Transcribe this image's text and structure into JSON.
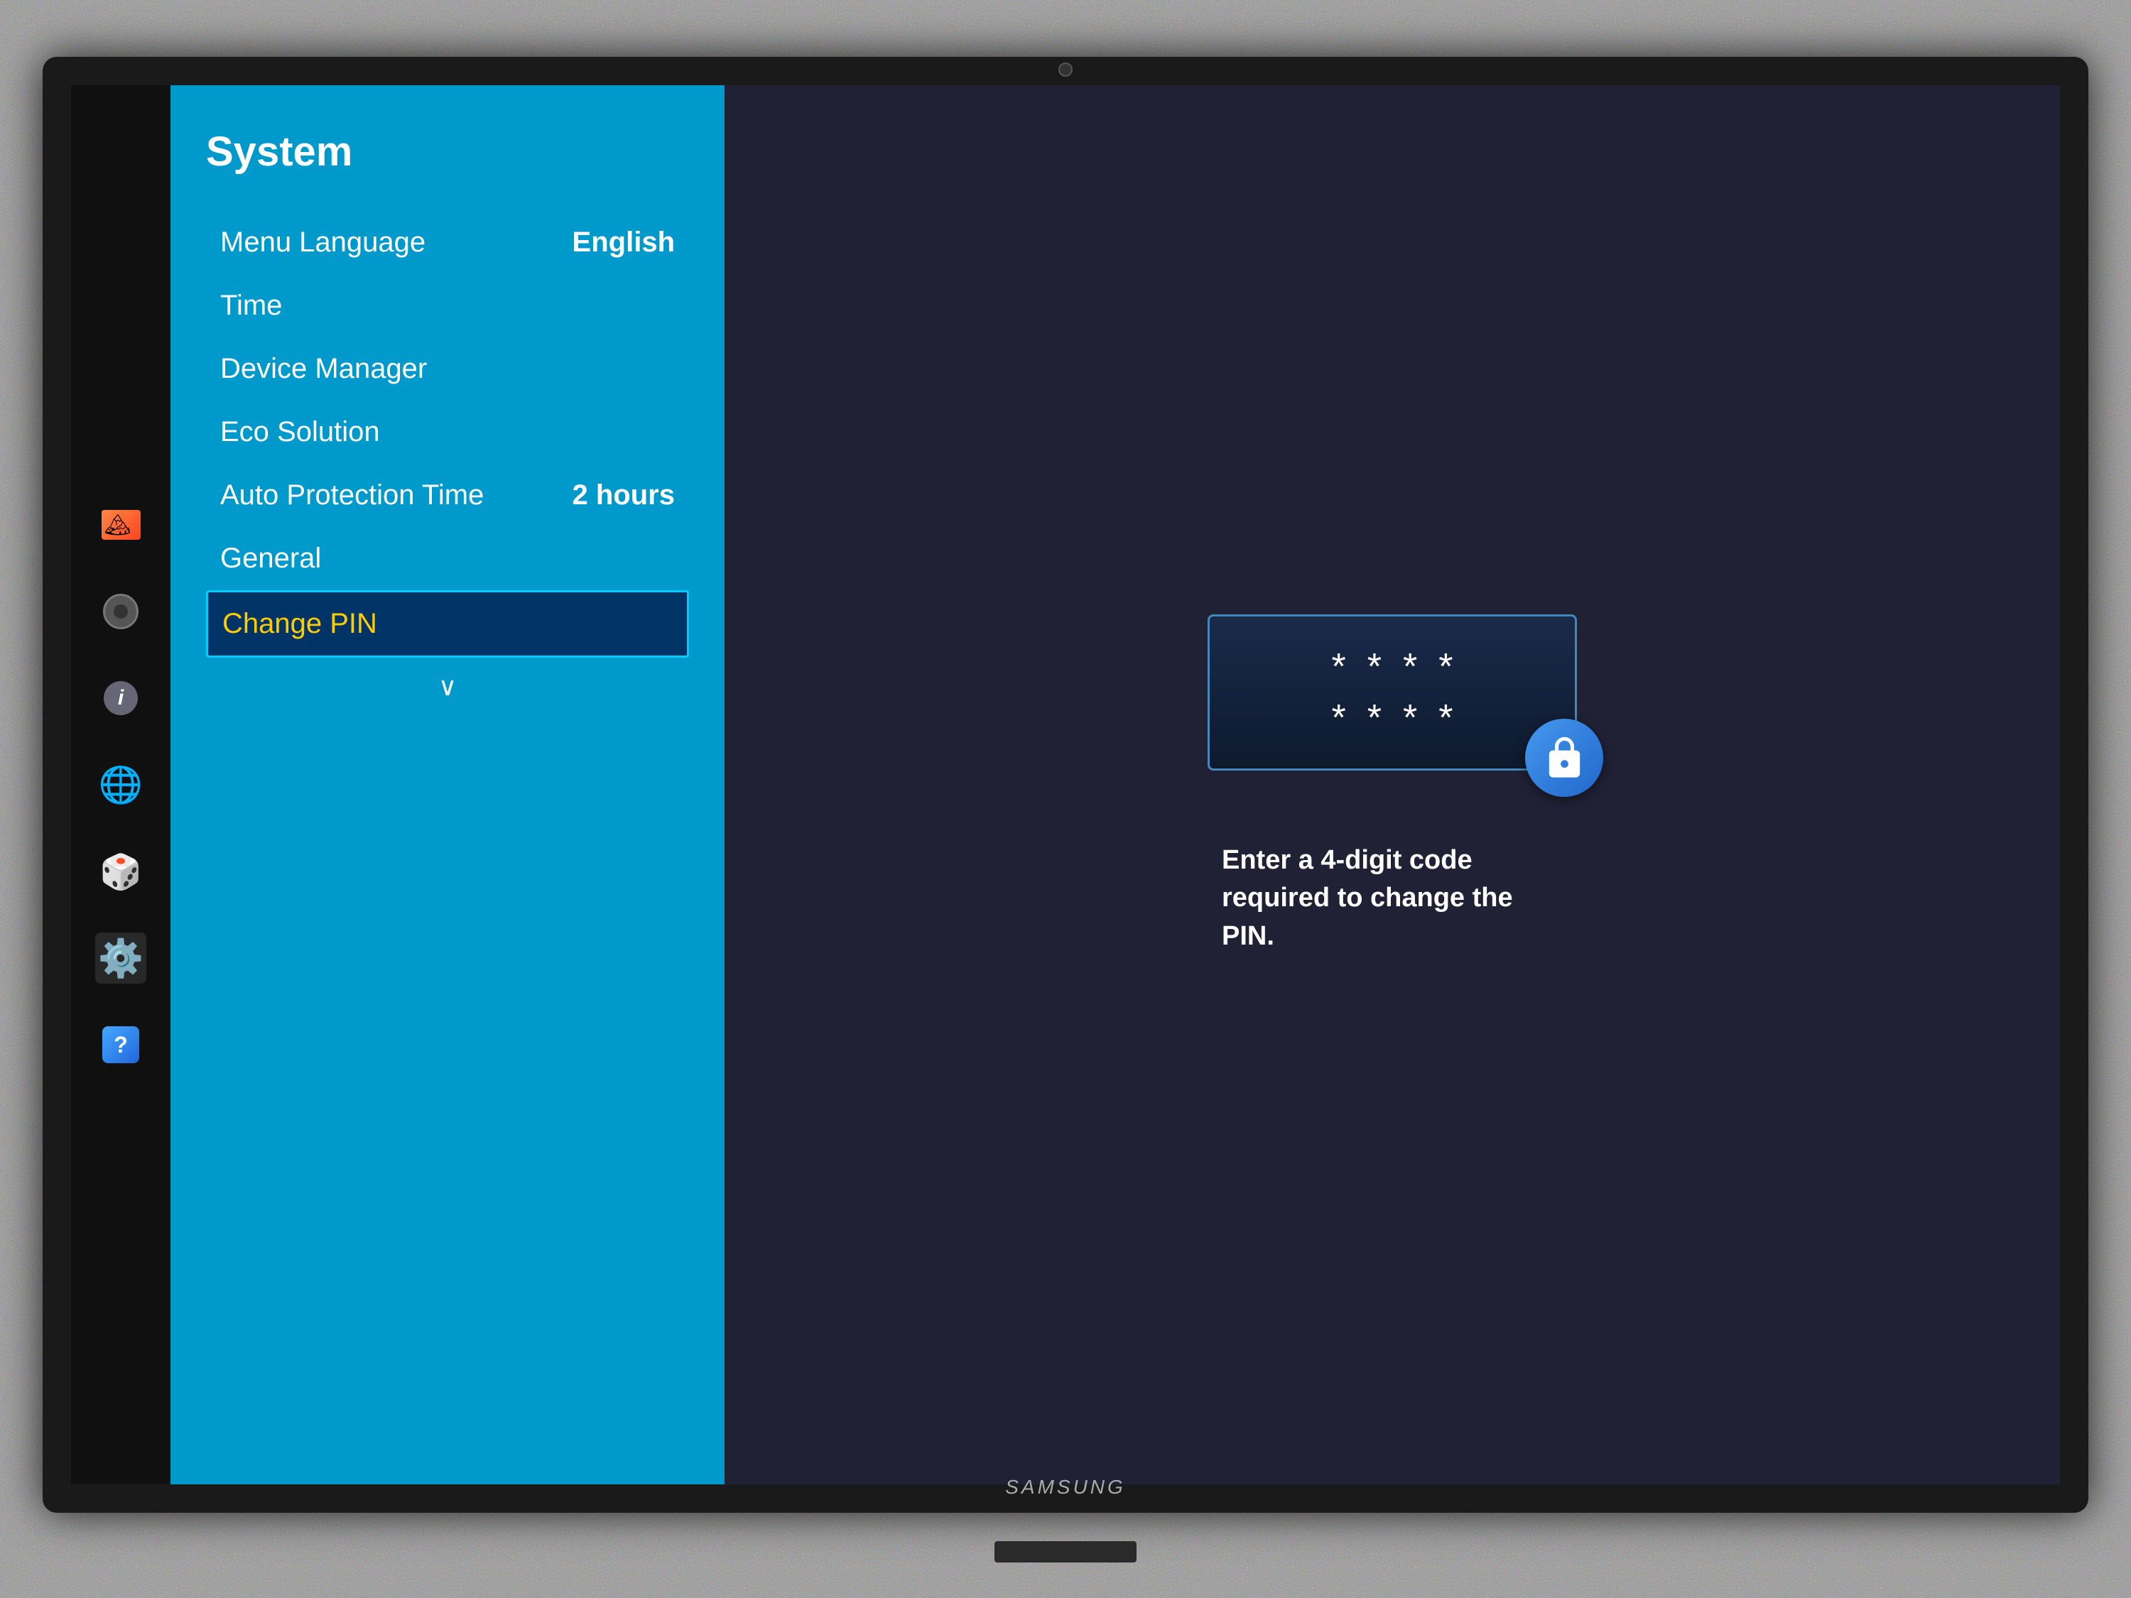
{
  "tv": {
    "brand": "SAMSUNG"
  },
  "sidebar": {
    "icons": [
      {
        "name": "photo-icon",
        "label": "Photos"
      },
      {
        "name": "speaker-icon",
        "label": "Sound"
      },
      {
        "name": "info-icon",
        "label": "Info"
      },
      {
        "name": "globe-icon",
        "label": "Network"
      },
      {
        "name": "apps-icon",
        "label": "Smart Hub"
      },
      {
        "name": "settings-icon",
        "label": "System",
        "active": true
      },
      {
        "name": "support-icon",
        "label": "Support"
      }
    ]
  },
  "system_menu": {
    "title": "System",
    "items": [
      {
        "label": "Menu Language",
        "value": "English",
        "selected": false
      },
      {
        "label": "Time",
        "value": "",
        "selected": false
      },
      {
        "label": "Device Manager",
        "value": "",
        "selected": false
      },
      {
        "label": "Eco Solution",
        "value": "",
        "selected": false
      },
      {
        "label": "Auto Protection Time",
        "value": "2 hours",
        "selected": false
      },
      {
        "label": "General",
        "value": "",
        "selected": false
      },
      {
        "label": "Change PIN",
        "value": "",
        "selected": true
      }
    ],
    "scroll_indicator": "∨"
  },
  "info_panel": {
    "pin_dots_row1": [
      "*",
      "*",
      "*",
      "*"
    ],
    "pin_dots_row2": [
      "*",
      "*",
      "*",
      "*"
    ],
    "description": "Enter a 4-digit code required to change the PIN."
  }
}
